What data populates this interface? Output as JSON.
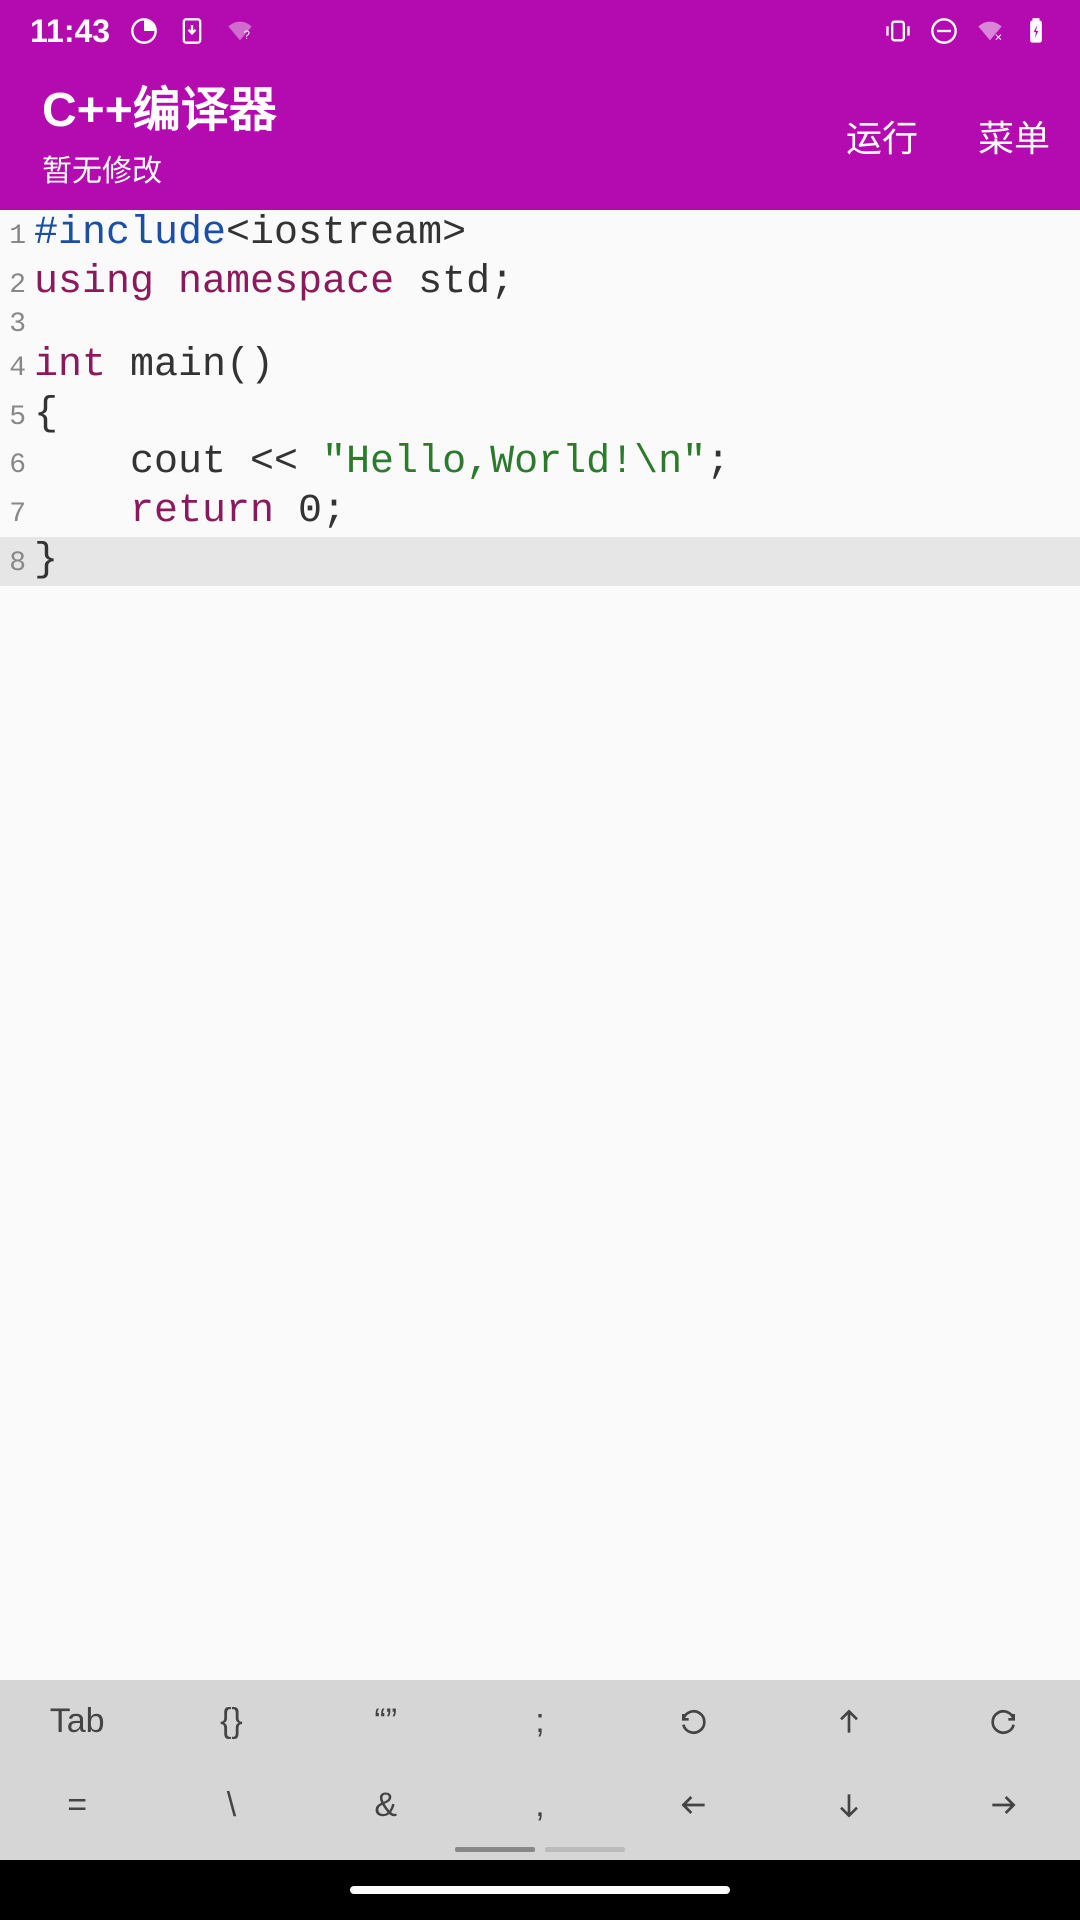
{
  "status_bar": {
    "time": "11:43"
  },
  "header": {
    "title": "C++编译器",
    "subtitle": "暂无修改",
    "run_label": "运行",
    "menu_label": "菜单"
  },
  "code": {
    "lines": [
      {
        "num": 1,
        "tokens": [
          {
            "t": "#include",
            "c": "preproc"
          },
          {
            "t": "<iostream>",
            "c": "default"
          }
        ]
      },
      {
        "num": 2,
        "tokens": [
          {
            "t": "using",
            "c": "keyword"
          },
          {
            "t": " ",
            "c": "default"
          },
          {
            "t": "namespace",
            "c": "keyword"
          },
          {
            "t": " std;",
            "c": "default"
          }
        ]
      },
      {
        "num": 3,
        "tokens": []
      },
      {
        "num": 4,
        "tokens": [
          {
            "t": "int",
            "c": "keyword"
          },
          {
            "t": " main()",
            "c": "default"
          }
        ]
      },
      {
        "num": 5,
        "tokens": [
          {
            "t": "{",
            "c": "default"
          }
        ]
      },
      {
        "num": 6,
        "tokens": [
          {
            "t": "    cout << ",
            "c": "default"
          },
          {
            "t": "\"Hello,World!\\n\"",
            "c": "string"
          },
          {
            "t": ";",
            "c": "default"
          }
        ]
      },
      {
        "num": 7,
        "tokens": [
          {
            "t": "    ",
            "c": "default"
          },
          {
            "t": "return",
            "c": "keyword"
          },
          {
            "t": " 0;",
            "c": "default"
          }
        ]
      },
      {
        "num": 8,
        "tokens": [
          {
            "t": "}",
            "c": "default"
          }
        ],
        "highlighted": true
      }
    ]
  },
  "toolbar": {
    "row1": [
      {
        "label": "Tab",
        "type": "text"
      },
      {
        "label": "{}",
        "type": "text"
      },
      {
        "label": "“”",
        "type": "text"
      },
      {
        "label": ";",
        "type": "text"
      },
      {
        "label": "undo",
        "type": "icon"
      },
      {
        "label": "up",
        "type": "icon"
      },
      {
        "label": "redo",
        "type": "icon"
      }
    ],
    "row2": [
      {
        "label": "=",
        "type": "text"
      },
      {
        "label": "\\",
        "type": "text"
      },
      {
        "label": "&",
        "type": "text"
      },
      {
        "label": ",",
        "type": "text"
      },
      {
        "label": "left",
        "type": "icon"
      },
      {
        "label": "down",
        "type": "icon"
      },
      {
        "label": "right",
        "type": "icon"
      }
    ]
  }
}
